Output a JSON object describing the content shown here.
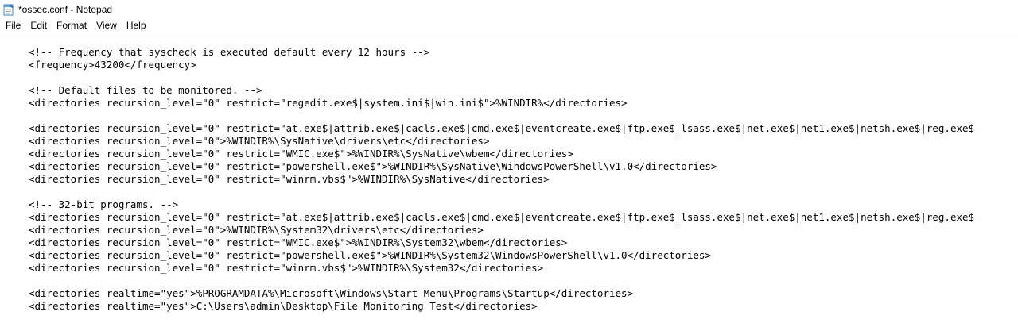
{
  "window": {
    "title": "*ossec.conf - Notepad",
    "icon": "notepad-icon"
  },
  "menu": {
    "items": [
      "File",
      "Edit",
      "Format",
      "View",
      "Help"
    ]
  },
  "editor": {
    "lines": [
      "<!-- Frequency that syscheck is executed default every 12 hours -->",
      "<frequency>43200</frequency>",
      "",
      "<!-- Default files to be monitored. -->",
      "<directories recursion_level=\"0\" restrict=\"regedit.exe$|system.ini$|win.ini$\">%WINDIR%</directories>",
      "",
      "<directories recursion_level=\"0\" restrict=\"at.exe$|attrib.exe$|cacls.exe$|cmd.exe$|eventcreate.exe$|ftp.exe$|lsass.exe$|net.exe$|net1.exe$|netsh.exe$|reg.exe$",
      "<directories recursion_level=\"0\">%WINDIR%\\SysNative\\drivers\\etc</directories>",
      "<directories recursion_level=\"0\" restrict=\"WMIC.exe$\">%WINDIR%\\SysNative\\wbem</directories>",
      "<directories recursion_level=\"0\" restrict=\"powershell.exe$\">%WINDIR%\\SysNative\\WindowsPowerShell\\v1.0</directories>",
      "<directories recursion_level=\"0\" restrict=\"winrm.vbs$\">%WINDIR%\\SysNative</directories>",
      "",
      "<!-- 32-bit programs. -->",
      "<directories recursion_level=\"0\" restrict=\"at.exe$|attrib.exe$|cacls.exe$|cmd.exe$|eventcreate.exe$|ftp.exe$|lsass.exe$|net.exe$|net1.exe$|netsh.exe$|reg.exe$",
      "<directories recursion_level=\"0\">%WINDIR%\\System32\\drivers\\etc</directories>",
      "<directories recursion_level=\"0\" restrict=\"WMIC.exe$\">%WINDIR%\\System32\\wbem</directories>",
      "<directories recursion_level=\"0\" restrict=\"powershell.exe$\">%WINDIR%\\System32\\WindowsPowerShell\\v1.0</directories>",
      "<directories recursion_level=\"0\" restrict=\"winrm.vbs$\">%WINDIR%\\System32</directories>",
      "",
      "<directories realtime=\"yes\">%PROGRAMDATA%\\Microsoft\\Windows\\Start Menu\\Programs\\Startup</directories>",
      "<directories realtime=\"yes\">C:\\Users\\admin\\Desktop\\File Monitoring Test</directories>"
    ]
  }
}
